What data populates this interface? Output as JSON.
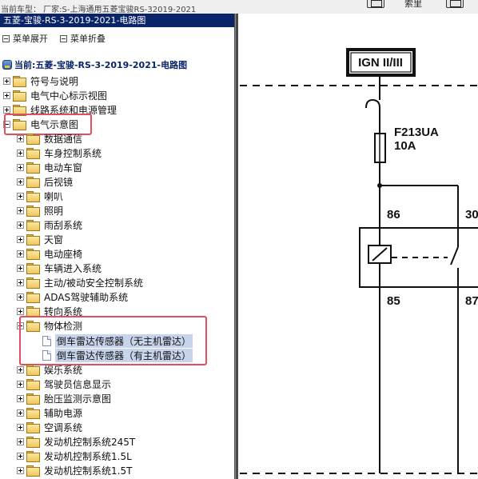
{
  "window": {
    "vehicle_label": "当前车型：  厂家:S-上海通用五菱宝骏RS-32019-2021",
    "toolbar_text": "索里"
  },
  "left_panel": {
    "title": "五菱-宝骏-RS-3-2019-2021-电路图",
    "expand_label": "菜单展开",
    "collapse_label": "菜单折叠",
    "current_label": "当前:五菱-宝骏-RS-3-2019-2021-电路图",
    "top_items": [
      {
        "label": "符号与说明"
      },
      {
        "label": "电气中心标示视图"
      },
      {
        "label": "线路系统和电源管理"
      },
      {
        "label": "电气示意图"
      }
    ],
    "sub_items": [
      {
        "label": "数据通信"
      },
      {
        "label": "车身控制系统"
      },
      {
        "label": "电动车窗"
      },
      {
        "label": "后视镜"
      },
      {
        "label": "喇叭"
      },
      {
        "label": "照明"
      },
      {
        "label": "雨刮系统"
      },
      {
        "label": "天窗"
      },
      {
        "label": "电动座椅"
      },
      {
        "label": "车辆进入系统"
      },
      {
        "label": "主动/被动安全控制系统"
      },
      {
        "label": "ADAS驾驶辅助系统"
      },
      {
        "label": "转向系统"
      },
      {
        "label": "物体检测"
      }
    ],
    "leaf_items": [
      {
        "label": "倒车雷达传感器（无主机雷达）"
      },
      {
        "label": "倒车雷达传感器（有主机雷达）"
      }
    ],
    "after_items": [
      {
        "label": "娱乐系统"
      },
      {
        "label": "驾驶员信息显示"
      },
      {
        "label": "胎压监测示意图"
      },
      {
        "label": "辅助电源"
      },
      {
        "label": "空调系统"
      },
      {
        "label": "发动机控制系统245T"
      },
      {
        "label": "发动机控制系统1.5L"
      },
      {
        "label": "发动机控制系统1.5T"
      }
    ]
  },
  "diagram": {
    "ign_label": "IGN II/III",
    "fuse_name": "F213UA",
    "fuse_rating": "10A",
    "pin_86": "86",
    "pin_30": "30",
    "pin_85": "85",
    "pin_87": "87"
  },
  "colors": {
    "title_bg": "#0a246a",
    "highlight": "#e05060",
    "selected_bg": "#c7d4ec"
  }
}
